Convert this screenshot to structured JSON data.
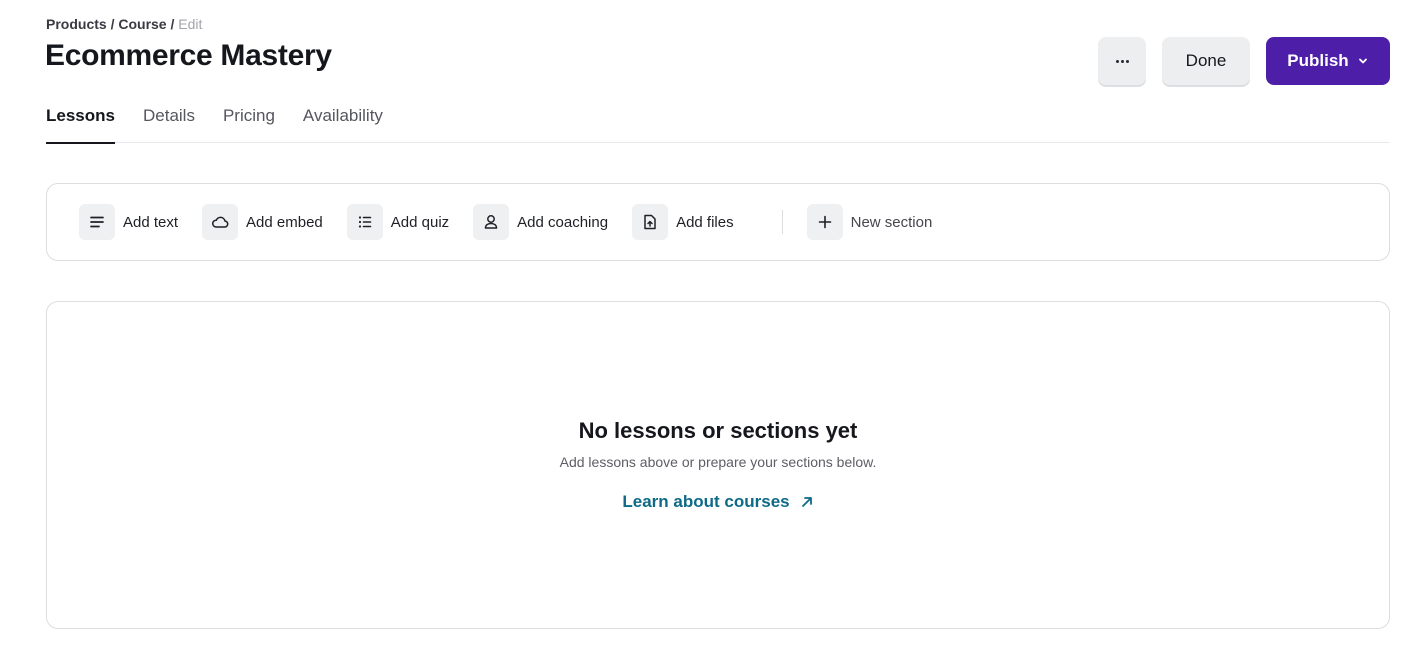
{
  "breadcrumb": {
    "items": [
      "Products",
      "Course"
    ],
    "separator": "/",
    "current": "Edit"
  },
  "page": {
    "title": "Ecommerce Mastery"
  },
  "actions": {
    "more_icon": "ellipsis-icon",
    "done_label": "Done",
    "publish_label": "Publish",
    "publish_icon": "chevron-down-icon",
    "publish_color": "#4d1fa8"
  },
  "tabs": [
    {
      "label": "Lessons",
      "active": true
    },
    {
      "label": "Details",
      "active": false
    },
    {
      "label": "Pricing",
      "active": false
    },
    {
      "label": "Availability",
      "active": false
    }
  ],
  "toolbar": {
    "items": [
      {
        "label": "Add text",
        "icon": "text-lines-icon"
      },
      {
        "label": "Add embed",
        "icon": "cloud-icon"
      },
      {
        "label": "Add quiz",
        "icon": "list-icon"
      },
      {
        "label": "Add coaching",
        "icon": "user-icon"
      },
      {
        "label": "Add files",
        "icon": "file-upload-icon"
      }
    ],
    "new_section": {
      "label": "New section",
      "icon": "plus-icon"
    }
  },
  "empty_state": {
    "title": "No lessons or sections yet",
    "subtitle": "Add lessons above or prepare your sections below.",
    "link_label": "Learn about courses",
    "link_icon": "arrow-up-right-icon",
    "link_color": "#0e6a86"
  }
}
